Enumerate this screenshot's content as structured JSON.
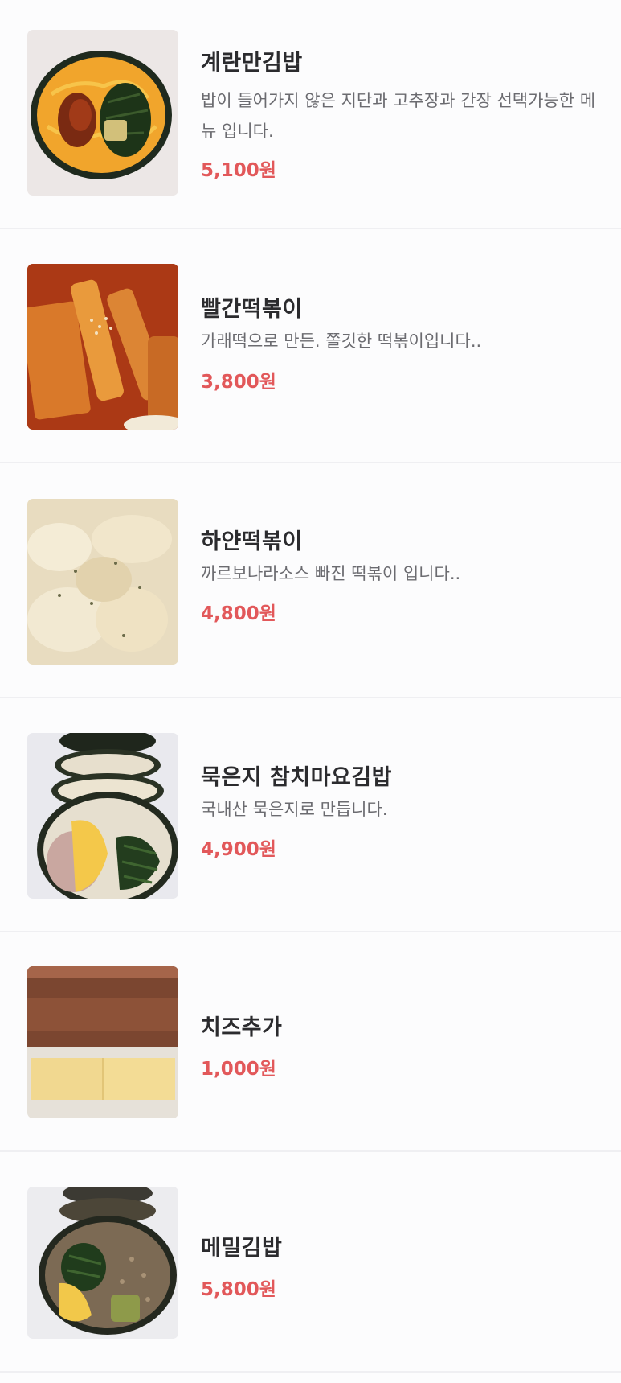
{
  "theme": {
    "price_color": "#e2585a",
    "name_color": "#2b2b2e",
    "desc_color": "#6b6b70",
    "divider_color": "#efeff2"
  },
  "menu": {
    "items": [
      {
        "name": "계란만김밥",
        "description": "밥이 들어가지 않은 지단과 고추장과 간장 선택가능한 메뉴 입니다.",
        "price": "5,100원",
        "image": "egg-kimbap-photo"
      },
      {
        "name": "빨간떡볶이",
        "description": "가래떡으로 만든. 쫄깃한 떡볶이입니다..",
        "price": "3,800원",
        "image": "red-tteokbokki-photo"
      },
      {
        "name": "하얀떡볶이",
        "description": "까르보나라소스 빠진 떡볶이 입니다..",
        "price": "4,800원",
        "image": "white-tteokbokki-photo"
      },
      {
        "name": "묵은지 참치마요김밥",
        "description": "국내산 묵은지로 만듭니다.",
        "price": "4,900원",
        "image": "tuna-mayo-kimbap-photo"
      },
      {
        "name": "치즈추가",
        "description": "",
        "price": "1,000원",
        "image": "cheese-slice-photo"
      },
      {
        "name": "메밀김밥",
        "description": "",
        "price": "5,800원",
        "image": "buckwheat-kimbap-photo"
      }
    ]
  }
}
